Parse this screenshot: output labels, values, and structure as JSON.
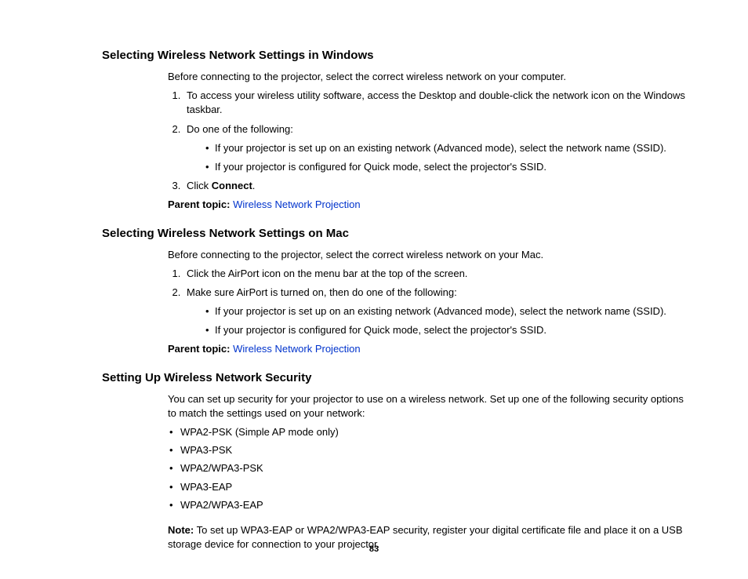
{
  "pageNumber": "83",
  "sections": [
    {
      "heading": "Selecting Wireless Network Settings in Windows",
      "intro": "Before connecting to the projector, select the correct wireless network on your computer.",
      "steps": [
        {
          "text": "To access your wireless utility software, access the Desktop and double-click the network icon on the Windows taskbar."
        },
        {
          "text": "Do one of the following:",
          "bullets": [
            "If your projector is set up on an existing network (Advanced mode), select the network name (SSID).",
            "If your projector is configured for Quick mode, select the projector's SSID."
          ]
        },
        {
          "prefix": "Click ",
          "bold": "Connect",
          "suffix": "."
        }
      ],
      "parentLabel": "Parent topic:",
      "parentLink": "Wireless Network Projection"
    },
    {
      "heading": "Selecting Wireless Network Settings on Mac",
      "intro": "Before connecting to the projector, select the correct wireless network on your Mac.",
      "steps": [
        {
          "text": "Click the AirPort icon on the menu bar at the top of the screen."
        },
        {
          "text": "Make sure AirPort is turned on, then do one of the following:",
          "bullets": [
            "If your projector is set up on an existing network (Advanced mode), select the network name (SSID).",
            "If your projector is configured for Quick mode, select the projector's SSID."
          ]
        }
      ],
      "parentLabel": "Parent topic:",
      "parentLink": "Wireless Network Projection"
    },
    {
      "heading": "Setting Up Wireless Network Security",
      "intro": "You can set up security for your projector to use on a wireless network. Set up one of the following security options to match the settings used on your network:",
      "bullets": [
        "WPA2-PSK (Simple AP mode only)",
        "WPA3-PSK",
        "WPA2/WPA3-PSK",
        "WPA3-EAP",
        "WPA2/WPA3-EAP"
      ],
      "noteLabel": "Note:",
      "noteText": " To set up WPA3-EAP or WPA2/WPA3-EAP security, register your digital certificate file and place it on a USB storage device for connection to your projector."
    }
  ]
}
